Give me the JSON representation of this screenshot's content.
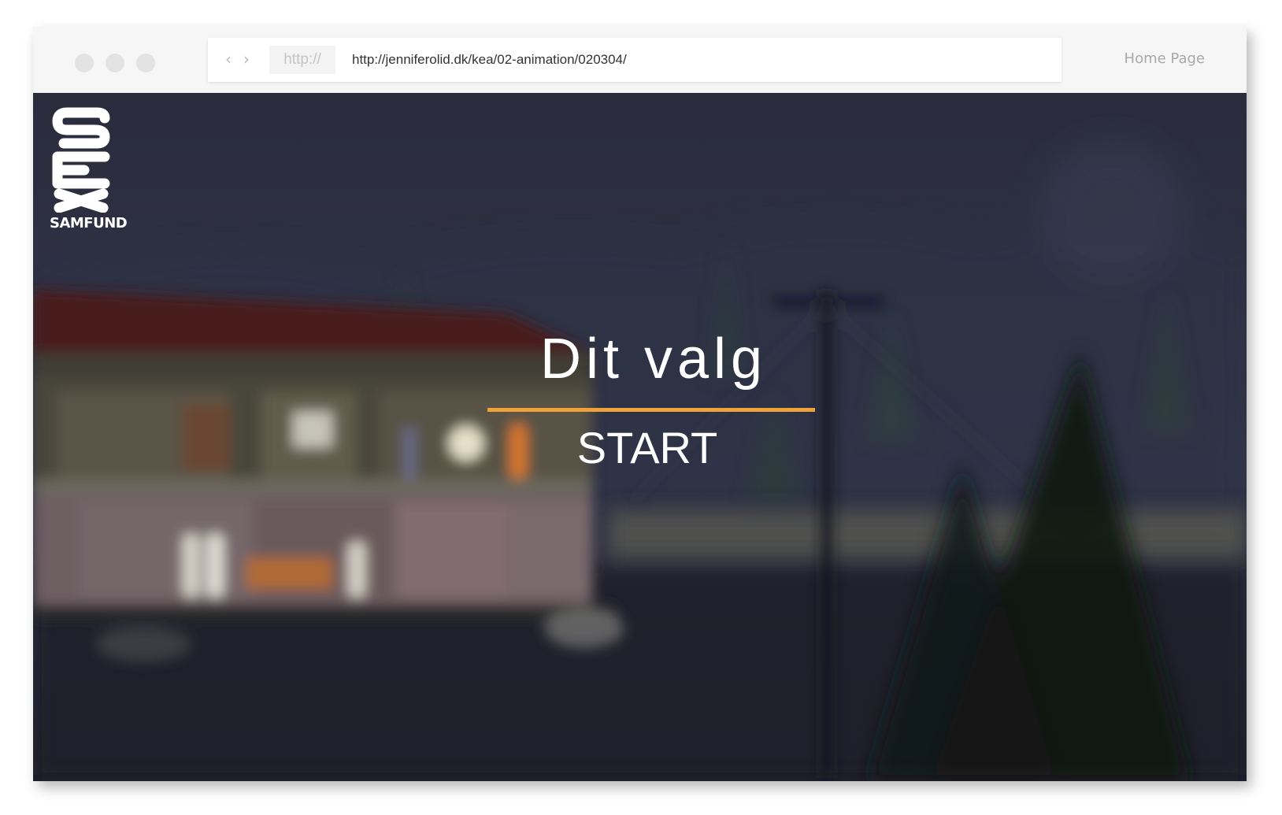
{
  "browser": {
    "protocol_label": "http://",
    "url": "http://jenniferolid.dk/kea/02-animation/020304/",
    "home_link": "Home Page",
    "nav_back_icon": "chevron-left-icon",
    "nav_forward_icon": "chevron-right-icon"
  },
  "page": {
    "logo": {
      "word": "SEX",
      "subtext": "SAMFUND"
    },
    "title": "Dit valg",
    "start_label": "START",
    "accent_color": "#f0a23a"
  }
}
